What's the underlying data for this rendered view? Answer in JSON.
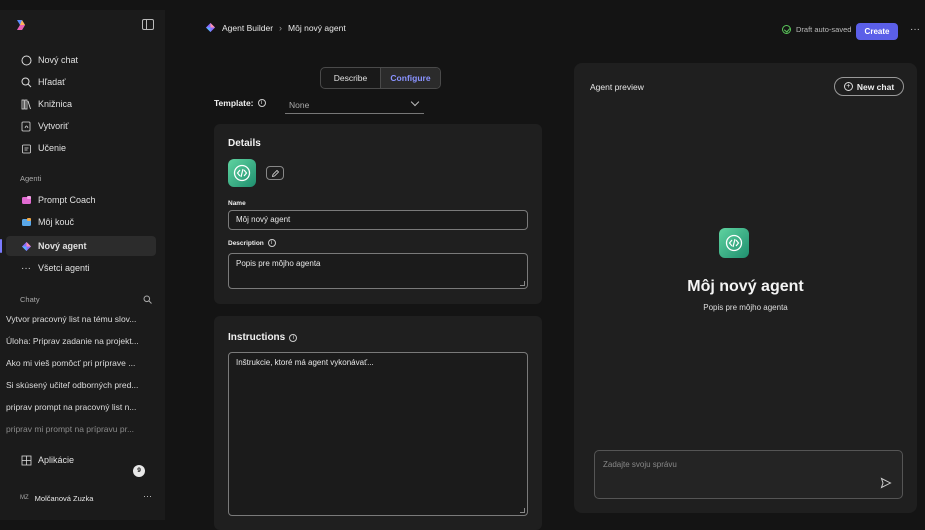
{
  "sidebar": {
    "nav": [
      {
        "label": "Nový chat",
        "icon": "chat-bubble-icon"
      },
      {
        "label": "Hľadať",
        "icon": "search-icon"
      },
      {
        "label": "Knižnica",
        "icon": "library-icon"
      },
      {
        "label": "Vytvoriť",
        "icon": "create-icon"
      },
      {
        "label": "Učenie",
        "icon": "learning-icon"
      }
    ],
    "agents_label": "Agenti",
    "agents": [
      {
        "label": "Prompt Coach",
        "icon": "prompt-coach-icon",
        "color": "#e06ad1"
      },
      {
        "label": "Môj kouč",
        "icon": "coach-icon",
        "color": "#5aa7e8"
      },
      {
        "label": "Nový agent",
        "icon": "agent-gem-icon",
        "color": "#8a6cff"
      },
      {
        "label": "Všetci agenti",
        "icon": "more-icon"
      }
    ],
    "chats_label": "Chaty",
    "chats": [
      "Vytvor pracovný list na tému slov...",
      "Úloha: Priprav zadanie na projekt...",
      "Ako mi vieš pomôcť pri príprave ...",
      "Si skúsený učiteľ odborných pred...",
      "priprav prompt na pracovný list n...",
      "priprav mi prompt na prípravu pr..."
    ],
    "apps_label": "Aplikácie",
    "apps_badge": "9",
    "user_initials": "MZ",
    "user_name": "Molčanová Zuzka",
    "user_more": "···"
  },
  "topbar": {
    "crumb_root": "Agent Builder",
    "crumb_sep": "›",
    "crumb_current": "Môj nový agent",
    "saved_status": "Draft auto-saved",
    "create_label": "Create",
    "more": "···"
  },
  "tabs": {
    "describe": "Describe",
    "configure": "Configure"
  },
  "template": {
    "label": "Template:",
    "value": "None"
  },
  "details": {
    "title": "Details",
    "name_label": "Name",
    "name_value": "Môj nový agent",
    "description_label": "Description",
    "description_value": "Popis pre môjho agenta"
  },
  "instructions": {
    "title": "Instructions",
    "value": "Inštrukcie, ktoré má agent vykonávať..."
  },
  "preview": {
    "title": "Agent preview",
    "new_chat_label": "New chat",
    "agent_name": "Môj nový agent",
    "agent_desc": "Popis pre môjho agenta",
    "message_placeholder": "Zadajte svoju správu"
  },
  "colors": {
    "accent": "#5b5fe8",
    "agent_icon": "#2fae82"
  }
}
